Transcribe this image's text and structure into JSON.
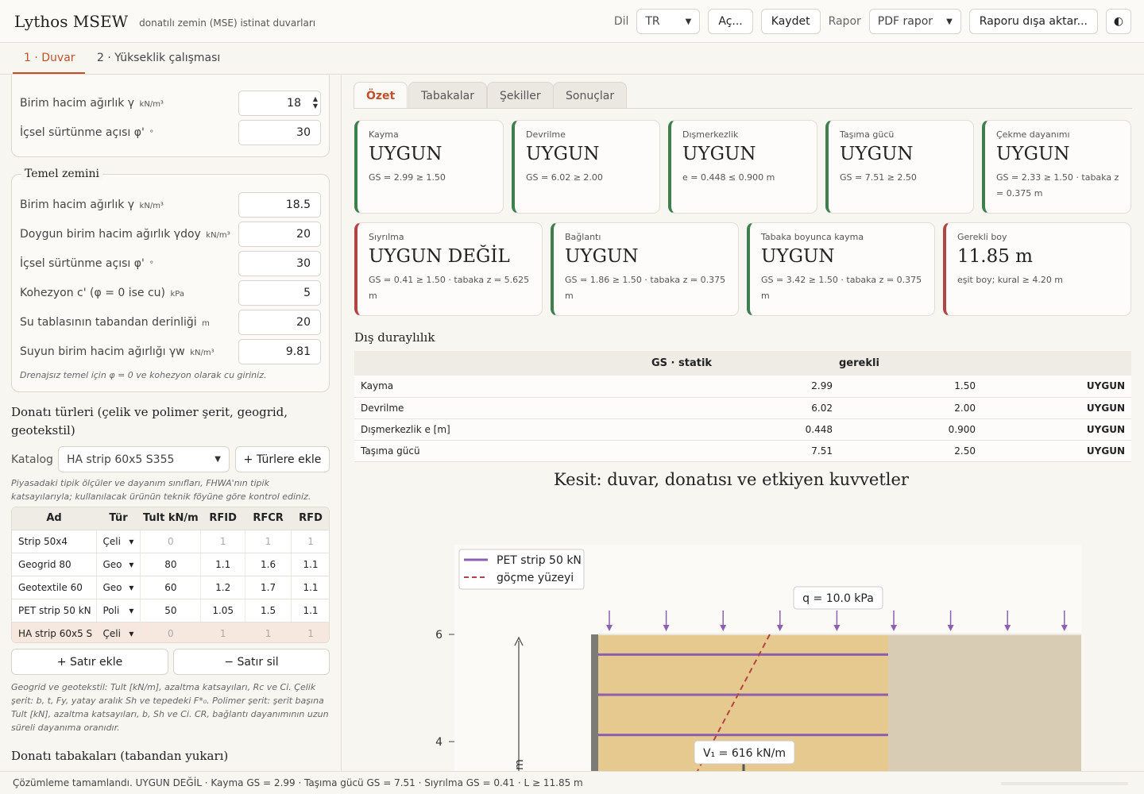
{
  "header": {
    "title": "Lythos MSEW",
    "subtitle": "donatılı zemin (MSE) istinat duvarları",
    "lang_label": "Dil",
    "lang_value": "TR",
    "open_label": "Aç...",
    "save_label": "Kaydet",
    "report_label": "Rapor",
    "report_value": "PDF rapor",
    "export_label": "Raporu dışa aktar...",
    "theme_icon": "◐"
  },
  "top_tabs": [
    "1 · Duvar",
    "2 · Yükseklik çalışması"
  ],
  "fill_soil": {
    "rows": [
      {
        "label": "Birim hacim ağırlık γ",
        "unit": "kN/m³",
        "value": "18"
      },
      {
        "label": "İçsel sürtünme açısı φ'",
        "unit": "°",
        "value": "30"
      }
    ]
  },
  "foundation": {
    "title": "Temel zemini",
    "rows": [
      {
        "label": "Birim hacim ağırlık γ",
        "unit": "kN/m³",
        "value": "18.5"
      },
      {
        "label": "Doygun birim hacim ağırlık γdoy",
        "unit": "kN/m³",
        "value": "20"
      },
      {
        "label": "İçsel sürtünme açısı φ'",
        "unit": "°",
        "value": "30"
      },
      {
        "label": "Kohezyon c' (φ = 0 ise cu)",
        "unit": "kPa",
        "value": "5"
      },
      {
        "label": "Su tablasının tabandan derinliği",
        "unit": "m",
        "value": "20"
      },
      {
        "label": "Suyun birim hacim ağırlığı γw",
        "unit": "kN/m³",
        "value": "9.81"
      }
    ],
    "note": "Drenajsız temel için φ = 0 ve kohezyon olarak cu giriniz."
  },
  "reinf_types": {
    "title": "Donatı türleri (çelik ve polimer şerit, geogrid, geotekstil)",
    "catalog_label": "Katalog",
    "catalog_value": "HA strip 60x5 S355",
    "add_types_label": "+ Türlere ekle",
    "catalog_note": "Piyasadaki tipik ölçüler ve dayanım sınıfları, FHWA'nın tipik katsayılarıyla; kullanılacak ürünün teknik föyüne göre kontrol ediniz.",
    "columns": [
      "Ad",
      "Tür",
      "Tult kN/m",
      "RFID",
      "RFCR",
      "RFD"
    ],
    "rows": [
      {
        "name": "Strip 50x4",
        "type": "Çeli",
        "tult": "0",
        "rfid": "1",
        "rfcr": "1",
        "rfd": "1",
        "dim": true
      },
      {
        "name": "Geogrid 80",
        "type": "Geo",
        "tult": "80",
        "rfid": "1.1",
        "rfcr": "1.6",
        "rfd": "1.1",
        "dim": false
      },
      {
        "name": "Geotextile 60",
        "type": "Geo",
        "tult": "60",
        "rfid": "1.2",
        "rfcr": "1.7",
        "rfd": "1.1",
        "dim": false
      },
      {
        "name": "PET strip 50 kN",
        "type": "Poli",
        "tult": "50",
        "rfid": "1.05",
        "rfcr": "1.5",
        "rfd": "1.1",
        "dim": false
      },
      {
        "name": "HA strip 60x5 S",
        "type": "Çeli",
        "tult": "0",
        "rfid": "1",
        "rfcr": "1",
        "rfd": "1",
        "dim": true
      }
    ],
    "add_row_label": "+ Satır ekle",
    "del_row_label": "− Satır sil",
    "help_note": "Geogrid ve geotekstil: Tult [kN/m], azaltma katsayıları, Rc ve Ci. Çelik şerit: b, t, Fy, yatay aralık Sh ve tepedeki F*₀. Polimer şerit: şerit başına Tult [kN], azaltma katsayıları, b, Sh ve Ci. CR, bağlantı dayanımının uzun süreli dayanıma oranıdır."
  },
  "layers_title": "Donatı tabakaları (tabandan yukarı)",
  "result_tabs": [
    "Özet",
    "Tabakalar",
    "Şekiller",
    "Sonuçlar"
  ],
  "cards": [
    {
      "label": "Kayma",
      "status": "UYGUN",
      "detail": "GS = 2.99 ≥ 1.50",
      "ok": true
    },
    {
      "label": "Devrilme",
      "status": "UYGUN",
      "detail": "GS = 6.02 ≥ 2.00",
      "ok": true
    },
    {
      "label": "Dışmerkezlik",
      "status": "UYGUN",
      "detail": "e = 0.448 ≤ 0.900 m",
      "ok": true
    },
    {
      "label": "Taşıma gücü",
      "status": "UYGUN",
      "detail": "GS = 7.51 ≥ 2.50",
      "ok": true
    },
    {
      "label": "Çekme dayanımı",
      "status": "UYGUN",
      "detail": "GS = 2.33 ≥ 1.50 · tabaka z = 0.375 m",
      "ok": true
    },
    {
      "label": "Sıyrılma",
      "status": "UYGUN DEĞİL",
      "detail": "GS = 0.41 ≥ 1.50 · tabaka z = 5.625 m",
      "ok": false
    },
    {
      "label": "Bağlantı",
      "status": "UYGUN",
      "detail": "GS = 1.86 ≥ 1.50 · tabaka z = 0.375 m",
      "ok": true
    },
    {
      "label": "Tabaka boyunca kayma",
      "status": "UYGUN",
      "detail": "GS = 3.42 ≥ 1.50 · tabaka z = 0.375 m",
      "ok": true
    },
    {
      "label": "Gerekli boy",
      "status": "11.85 m",
      "detail": "eşit boy; kural ≥ 4.20 m",
      "ok": false
    }
  ],
  "external": {
    "title": "Dış duraylılık",
    "col_fs": "GS · statik",
    "col_req": "gerekli",
    "rows": [
      {
        "name": "Kayma",
        "fs": "2.99",
        "req": "1.50",
        "verdict": "UYGUN"
      },
      {
        "name": "Devrilme",
        "fs": "6.02",
        "req": "2.00",
        "verdict": "UYGUN"
      },
      {
        "name": "Dışmerkezlik e [m]",
        "fs": "0.448",
        "req": "0.900",
        "verdict": "UYGUN"
      },
      {
        "name": "Taşıma gücü",
        "fs": "7.51",
        "req": "2.50",
        "verdict": "UYGUN"
      }
    ]
  },
  "section": {
    "title": "Kesit: duvar, donatısı ve etkiyen kuvvetler",
    "legend": [
      "PET strip 50 kN",
      "göçme yüzeyi"
    ],
    "surcharge_label": "q = 10.0 kPa",
    "v1_label": "V₁ = 616 kN/m",
    "y_axis_label": "m",
    "y_ticks": [
      4,
      6
    ],
    "reinf_levels": [
      5.625,
      4.875,
      4.125
    ],
    "wall_top": 6.0,
    "colors": {
      "reinforced": "#e6c98f",
      "retained": "#d9ccb4",
      "reinf": "#8c5fb0",
      "failure": "#b34444",
      "face": "#7c7c76",
      "arrow": "#8c5fb0"
    }
  },
  "status_text": "Çözümleme tamamlandı. UYGUN DEĞİL · Kayma GS = 2.99 · Taşıma gücü GS = 7.51 · Sıyrılma GS = 0.41 · L ≥ 11.85 m"
}
